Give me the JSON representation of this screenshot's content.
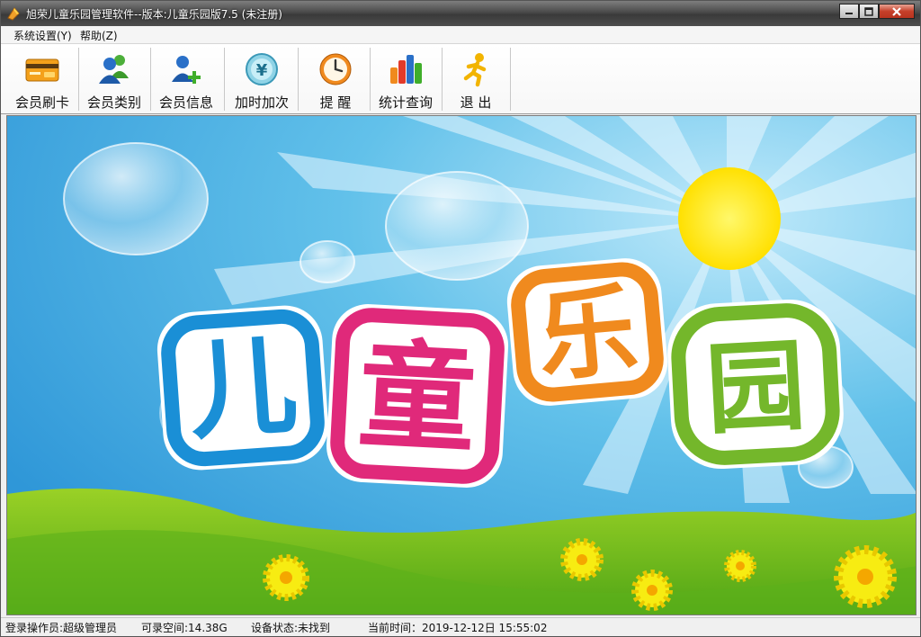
{
  "window": {
    "title": "旭荣儿童乐园管理软件--版本:儿童乐园版7.5 (未注册)"
  },
  "menu": {
    "items": [
      {
        "label": "系统设置(Y)"
      },
      {
        "label": "帮助(Z)"
      }
    ]
  },
  "toolbar": {
    "buttons": [
      {
        "label": "会员刷卡",
        "icon": "member-card-icon"
      },
      {
        "label": "会员类别",
        "icon": "member-category-icon"
      },
      {
        "label": "会员信息",
        "icon": "member-info-icon"
      },
      {
        "label": "加时加次",
        "icon": "yen-coin-icon"
      },
      {
        "label": "提  醒",
        "icon": "clock-icon"
      },
      {
        "label": "统计查询",
        "icon": "bar-chart-icon"
      },
      {
        "label": "退  出",
        "icon": "running-man-icon"
      }
    ]
  },
  "banner": {
    "text": "儿童乐园",
    "char_colors": [
      "#1a8fd6",
      "#e0297a",
      "#f08a1e",
      "#74b72b"
    ]
  },
  "statusbar": {
    "operator": "登录操作员:超级管理员",
    "space": "可录空间:14.38G",
    "device": "设备状态:未找到",
    "time": "当前时间：2019-12-12日 15:55:02"
  }
}
